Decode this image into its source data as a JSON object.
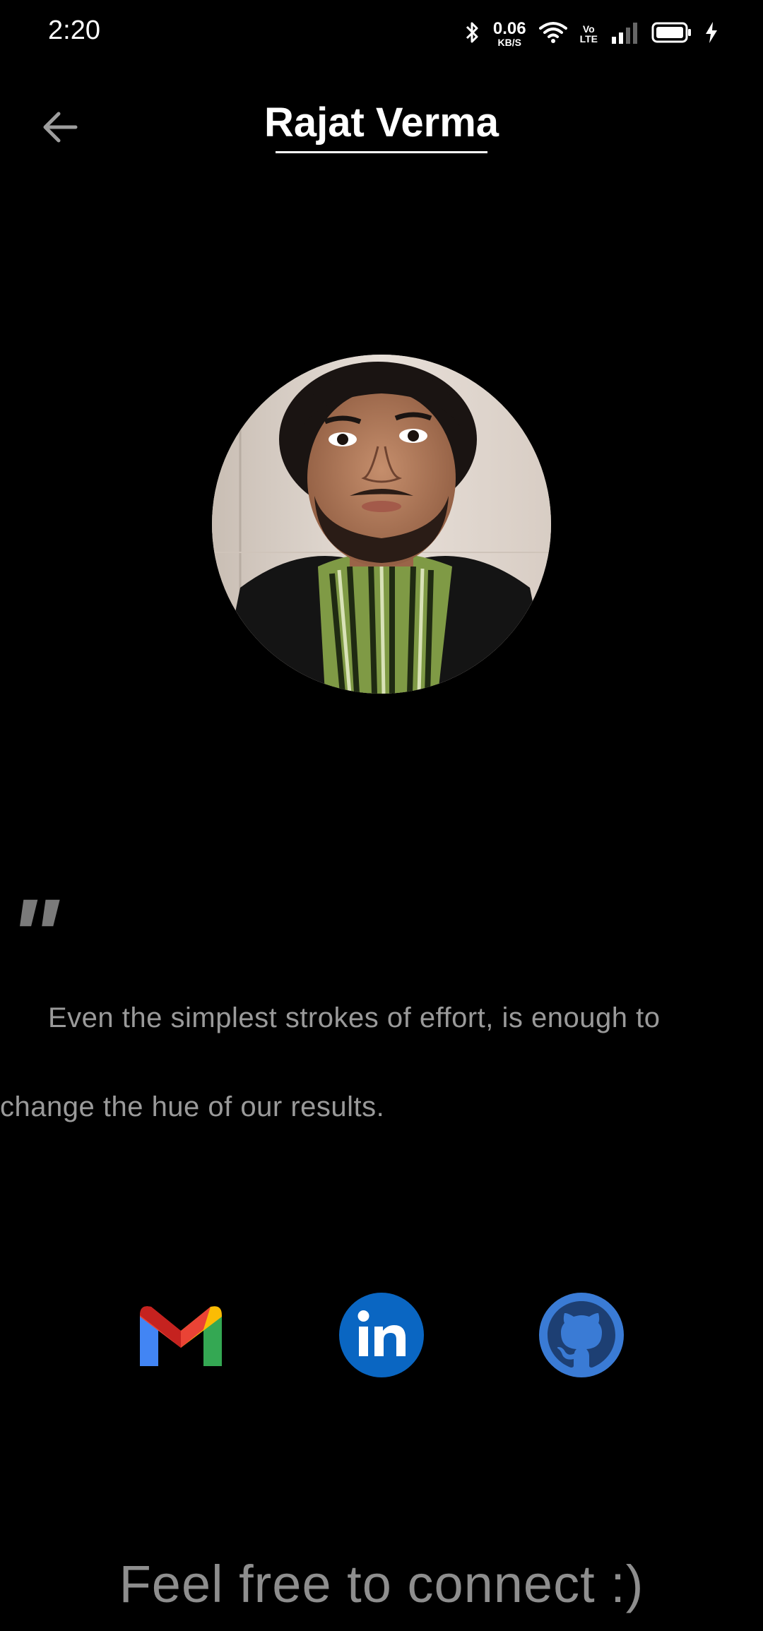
{
  "status_bar": {
    "time": "2:20",
    "net_speed_value": "0.06",
    "net_speed_unit": "KB/S",
    "volte_top": "Vo",
    "volte_bottom": "LTE",
    "icons": [
      "bluetooth-icon",
      "wifi-icon",
      "signal-icon",
      "battery-icon",
      "charging-icon"
    ]
  },
  "header": {
    "title": "Rajat Verma",
    "back_icon": "arrow-left-icon"
  },
  "profile": {
    "avatar": "profile-photo"
  },
  "quote": {
    "mark": "\"",
    "text": "Even the simplest strokes of effort, is enough to change the hue of our results."
  },
  "social": {
    "items": [
      {
        "name": "gmail",
        "icon": "gmail-icon",
        "color": "#EA4335"
      },
      {
        "name": "linkedin",
        "icon": "linkedin-icon",
        "color": "#0A66C2"
      },
      {
        "name": "github",
        "icon": "github-icon",
        "color": "#3A7BD5"
      }
    ]
  },
  "footer": {
    "text": "Feel free to connect :)"
  },
  "colors": {
    "background": "#000000",
    "title": "#FFFFFF",
    "quote": "#9A9A9A",
    "footer": "#8E8E8E"
  }
}
